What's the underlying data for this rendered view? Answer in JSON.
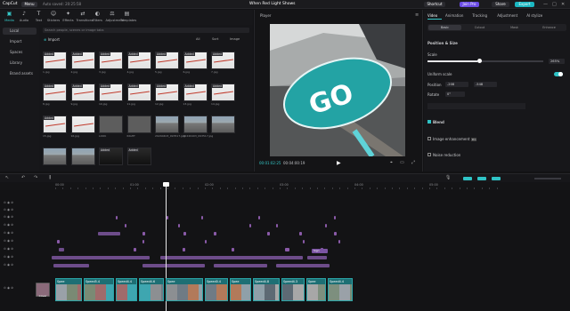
{
  "app": {
    "name": "CapCut",
    "menu_label": "Menu",
    "autosave": "Auto saved: 20:25:58",
    "project_title": "When Red Light Shows",
    "shortcut_label": "Shortcut",
    "join_pro_label": "Join Pro",
    "share_label": "Share",
    "export_label": "Export"
  },
  "tools": [
    {
      "icon": "▣",
      "label": "Media"
    },
    {
      "icon": "♪",
      "label": "Audio"
    },
    {
      "icon": "T",
      "label": "Text"
    },
    {
      "icon": "☺",
      "label": "Stickers"
    },
    {
      "icon": "✦",
      "label": "Effects"
    },
    {
      "icon": "⇄",
      "label": "Transitions"
    },
    {
      "icon": "◐",
      "label": "Filters"
    },
    {
      "icon": "⚖",
      "label": "Adjustment"
    },
    {
      "icon": "▤",
      "label": "Templates"
    }
  ],
  "side_nav": {
    "local_label": "Local",
    "items": [
      "Import",
      "Spaces",
      "Library",
      "Brand assets"
    ]
  },
  "media": {
    "search_placeholder": "Search people, scenes or image tabs",
    "import_label": "Import",
    "all_label": "All",
    "sort_label": "Sort",
    "filter_label": "Image",
    "thumbs": [
      {
        "badge": "Added",
        "name": "1.jpg",
        "kind": "map"
      },
      {
        "badge": "Added",
        "name": "2.jpg",
        "kind": "map"
      },
      {
        "badge": "Added",
        "name": "3.jpg",
        "kind": "map"
      },
      {
        "badge": "Added",
        "name": "4.jpg",
        "kind": "map"
      },
      {
        "badge": "Added",
        "name": "5.jpg",
        "kind": "map"
      },
      {
        "badge": "Added",
        "name": "6.jpg",
        "kind": "map"
      },
      {
        "badge": "Added",
        "name": "7.jpg",
        "kind": "map"
      },
      {
        "badge": "Added",
        "name": "8.jpg",
        "kind": "map"
      },
      {
        "badge": "Added",
        "name": "9.jpg",
        "kind": "map"
      },
      {
        "badge": "Added",
        "name": "10.jpg",
        "kind": "map"
      },
      {
        "badge": "Added",
        "name": "11.jpg",
        "kind": "map"
      },
      {
        "badge": "Added",
        "name": "12.jpg",
        "kind": "map"
      },
      {
        "badge": "Added",
        "name": "13.jpg",
        "kind": "map"
      },
      {
        "badge": "Added",
        "name": "14.jpg",
        "kind": "map"
      },
      {
        "badge": "Added",
        "name": "15.jpg",
        "kind": "map"
      },
      {
        "badge": "",
        "name": "16.jpg",
        "kind": "map"
      },
      {
        "badge": "",
        "name": "LOOK",
        "kind": "txt"
      },
      {
        "badge": "",
        "name": "RIGHT",
        "kind": "txt"
      },
      {
        "badge": "",
        "name": "20240403_093517.jpg",
        "kind": "road"
      },
      {
        "badge": "",
        "name": "20240403_093517.jpg",
        "kind": "road"
      },
      {
        "badge": "",
        "name": "",
        "kind": "road"
      },
      {
        "badge": "",
        "name": "",
        "kind": "road"
      },
      {
        "badge": "",
        "name": "",
        "kind": "road"
      },
      {
        "badge": "Added",
        "name": "",
        "kind": "dark"
      },
      {
        "badge": "Added",
        "name": "",
        "kind": "dark"
      }
    ]
  },
  "player": {
    "title": "Player",
    "current_time": "00:01:02:25",
    "duration": "00:04:00:19",
    "overlay_text": "GO",
    "play_icon": "play-icon"
  },
  "properties": {
    "tabs": [
      "Video",
      "Animation",
      "Tracking",
      "Adjustment",
      "AI stylize"
    ],
    "sub_tabs": [
      "Basic",
      "Cutout",
      "Mask",
      "Enhance"
    ],
    "section_position": "Position & Size",
    "scale_label": "Scale",
    "scale_value": "265%",
    "uniform_scale_label": "Uniform scale",
    "position_label": "Position",
    "pos_x": "-208",
    "pos_y": "-548",
    "rotate_label": "Rotate",
    "rotate_value": "0°",
    "blend_label": "Blend",
    "image_enhance_label": "Image enhancement",
    "noise_label": "Noise reduction",
    "pro_badge": "Pro"
  },
  "timeline": {
    "ruler_labels": [
      "00:00",
      "01:00",
      "02:00",
      "03:00",
      "04:00",
      "05:00"
    ],
    "cover_label": "Cover",
    "clip_labels": [
      "Spee",
      "Speed5.4",
      "Speed4.4",
      "Speed4.6",
      "Spee",
      "Speed0.4",
      "Spee",
      "Speed4.8",
      "Speed4.3",
      "Spee",
      "Speed4.4"
    ],
    "audio_clip": "Sign"
  }
}
